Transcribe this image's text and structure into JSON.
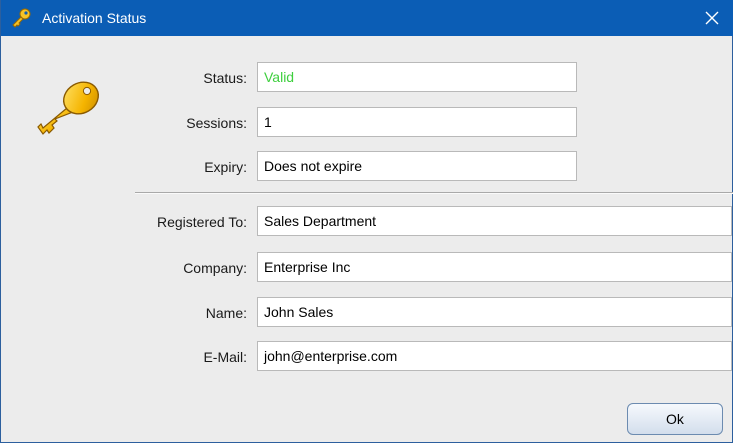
{
  "window": {
    "title": "Activation Status",
    "title_icon": "key-icon",
    "close_icon": "close-icon"
  },
  "main_icon": "key-icon",
  "fields": {
    "status": {
      "label": "Status:",
      "value": "Valid",
      "value_color": "#3ecf3e"
    },
    "sessions": {
      "label": "Sessions:",
      "value": "1"
    },
    "expiry": {
      "label": "Expiry:",
      "value": "Does not expire"
    },
    "registered_to": {
      "label": "Registered To:",
      "value": "Sales Department"
    },
    "company": {
      "label": "Company:",
      "value": "Enterprise Inc"
    },
    "name": {
      "label": "Name:",
      "value": "John Sales"
    },
    "email": {
      "label": "E-Mail:",
      "value": "john@enterprise.com"
    }
  },
  "buttons": {
    "ok": "Ok"
  },
  "colors": {
    "titlebar": "#0b5db5",
    "background": "#ececec"
  }
}
